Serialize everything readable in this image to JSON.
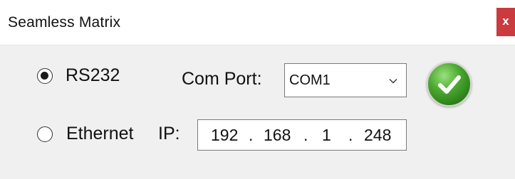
{
  "window": {
    "title": "Seamless Matrix",
    "close_label": "x"
  },
  "connection": {
    "rs232": {
      "label": "RS232",
      "selected": true
    },
    "ethernet": {
      "label": "Ethernet",
      "selected": false
    },
    "com_port": {
      "label": "Com Port:",
      "value": "COM1"
    },
    "ip": {
      "label": "IP:",
      "octets": [
        "192",
        "168",
        "1",
        "248"
      ],
      "separator": "."
    }
  },
  "icons": {
    "dropdown": "chevron-down-icon",
    "confirm": "checkmark-icon"
  },
  "colors": {
    "close_button": "#c93b3f",
    "confirm_button": "#3f9a27"
  }
}
